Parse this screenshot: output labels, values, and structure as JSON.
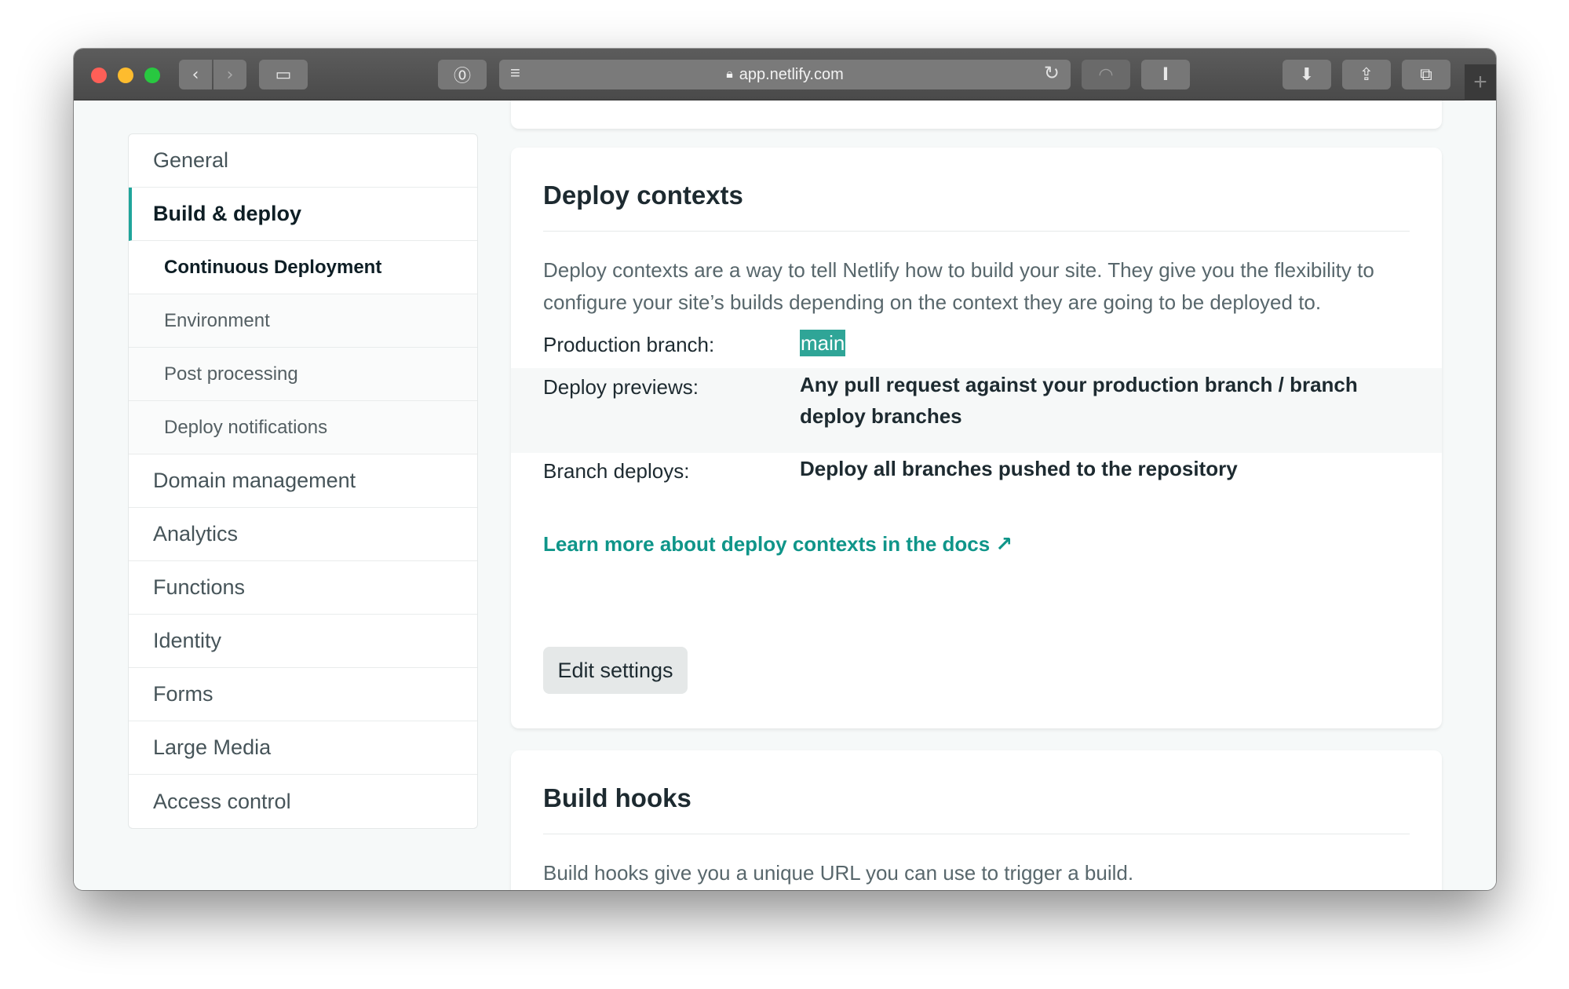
{
  "browser": {
    "url": "app.netlify.com"
  },
  "sidebar": {
    "items": [
      {
        "label": "General"
      },
      {
        "label": "Build & deploy"
      },
      {
        "label": "Domain management"
      },
      {
        "label": "Analytics"
      },
      {
        "label": "Functions"
      },
      {
        "label": "Identity"
      },
      {
        "label": "Forms"
      },
      {
        "label": "Large Media"
      },
      {
        "label": "Access control"
      }
    ],
    "subitems": [
      {
        "label": "Continuous Deployment"
      },
      {
        "label": "Environment"
      },
      {
        "label": "Post processing"
      },
      {
        "label": "Deploy notifications"
      }
    ]
  },
  "deploy_contexts": {
    "title": "Deploy contexts",
    "description": "Deploy contexts are a way to tell Netlify how to build your site. They give you the flexibility to configure your site’s builds depending on the context they are going to be deployed to.",
    "rows": [
      {
        "label": "Production branch:",
        "value": "main"
      },
      {
        "label": "Deploy previews:",
        "value": "Any pull request against your production branch / branch deploy branches"
      },
      {
        "label": "Branch deploys:",
        "value": "Deploy all branches pushed to the repository"
      }
    ],
    "docs_link": "Learn more about deploy contexts in the docs ↗",
    "edit_button": "Edit settings"
  },
  "build_hooks": {
    "title": "Build hooks",
    "description": "Build hooks give you a unique URL you can use to trigger a build."
  },
  "colors": {
    "accent": "#1fa59b",
    "link": "#0f9589",
    "branch_highlight": "#2fa597"
  }
}
